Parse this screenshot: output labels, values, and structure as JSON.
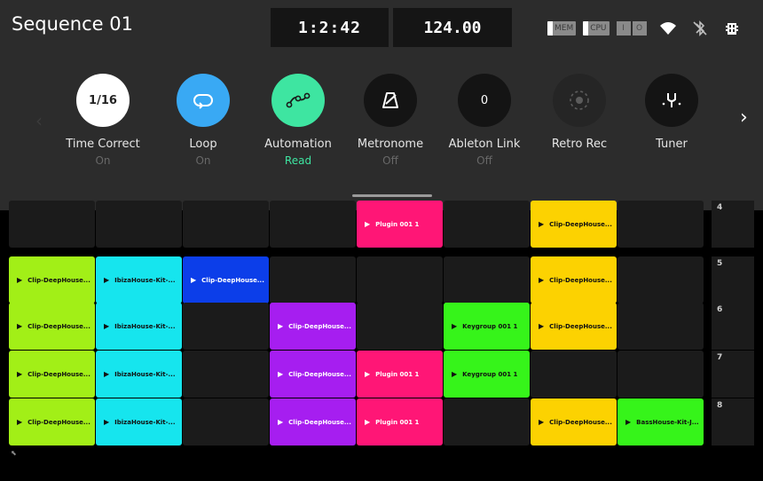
{
  "header": {
    "title": "Sequence 01",
    "time": "1:2:42",
    "bpm": "124.00",
    "mem_label": "MEM",
    "cpu_label": "CPU",
    "io_in": "I",
    "io_out": "O"
  },
  "toolbar": {
    "items": [
      {
        "label": "Time Correct",
        "state": "On",
        "value": "1/16"
      },
      {
        "label": "Loop",
        "state": "On"
      },
      {
        "label": "Automation",
        "state": "Read"
      },
      {
        "label": "Metronome",
        "state": "Off"
      },
      {
        "label": "Ableton Link",
        "state": "Off",
        "value": "0"
      },
      {
        "label": "Retro Rec"
      },
      {
        "label": "Tuner"
      }
    ]
  },
  "colors": {
    "loop": "#39a9f4",
    "automation": "#3ee5a1",
    "lime": "#a2ef17",
    "cyan": "#16e5ee",
    "blue": "#0c3ee9",
    "purple": "#a61ef0",
    "pink": "#ff1676",
    "green": "#36f41a",
    "yellow": "#fcd201",
    "empty": "#1b1b1b"
  },
  "grid": {
    "rows": [
      {
        "number": "4",
        "cells": [
          null,
          null,
          null,
          null,
          {
            "name": "Plugin 001 1",
            "color": "pink"
          },
          null,
          {
            "name": "Clip-DeepHouse...",
            "color": "yellow"
          },
          null
        ]
      },
      {
        "number": "5",
        "cells": [
          {
            "name": "Clip-DeepHouse...",
            "color": "lime"
          },
          {
            "name": "IbizaHouse-Kit-...",
            "color": "cyan"
          },
          {
            "name": "Clip-DeepHouse...",
            "color": "blue"
          },
          null,
          null,
          null,
          {
            "name": "Clip-DeepHouse...",
            "color": "yellow"
          },
          null
        ]
      },
      {
        "number": "6",
        "cells": [
          {
            "name": "Clip-DeepHouse...",
            "color": "lime"
          },
          {
            "name": "IbizaHouse-Kit-...",
            "color": "cyan"
          },
          null,
          {
            "name": "Clip-DeepHouse...",
            "color": "purple"
          },
          null,
          {
            "name": "Keygroup 001 1",
            "color": "green"
          },
          {
            "name": "Clip-DeepHouse...",
            "color": "yellow"
          },
          null
        ]
      },
      {
        "number": "7",
        "cells": [
          {
            "name": "Clip-DeepHouse...",
            "color": "lime"
          },
          {
            "name": "IbizaHouse-Kit-...",
            "color": "cyan"
          },
          null,
          {
            "name": "Clip-DeepHouse...",
            "color": "purple"
          },
          {
            "name": "Plugin 001 1",
            "color": "pink"
          },
          {
            "name": "Keygroup 001 1",
            "color": "green"
          },
          null,
          null
        ]
      },
      {
        "number": "8",
        "cells": [
          {
            "name": "Clip-DeepHouse...",
            "color": "lime"
          },
          {
            "name": "IbizaHouse-Kit-...",
            "color": "cyan"
          },
          null,
          {
            "name": "Clip-DeepHouse...",
            "color": "purple"
          },
          {
            "name": "Plugin 001 1",
            "color": "pink"
          },
          null,
          {
            "name": "Clip-DeepHouse...",
            "color": "yellow"
          },
          {
            "name": "BassHouse-Kit-J...",
            "color": "green"
          }
        ]
      }
    ]
  }
}
